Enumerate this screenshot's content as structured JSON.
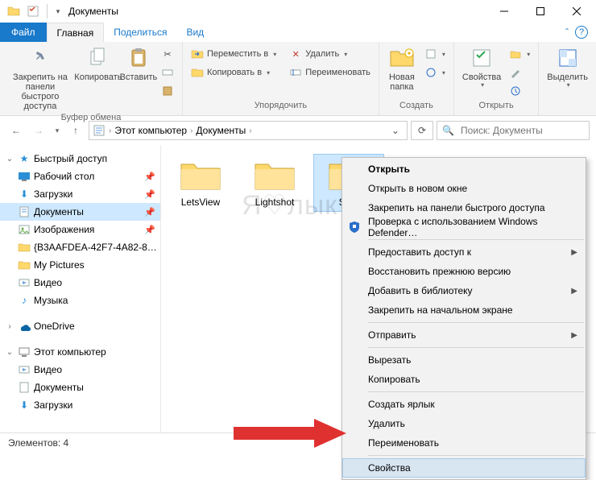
{
  "window": {
    "title": "Документы"
  },
  "tabs": {
    "file": "Файл",
    "home": "Главная",
    "share": "Поделиться",
    "view": "Вид"
  },
  "ribbon": {
    "clipboard": {
      "pin": "Закрепить на панели\nбыстрого доступа",
      "copy": "Копировать",
      "paste": "Вставить",
      "label": "Буфер обмена"
    },
    "organize": {
      "move_to": "Переместить в",
      "copy_to": "Копировать в",
      "delete": "Удалить",
      "rename": "Переименовать",
      "label": "Упорядочить"
    },
    "new": {
      "new_folder": "Новая\nпапка",
      "label": "Создать"
    },
    "open": {
      "properties": "Свойства",
      "label": "Открыть"
    },
    "select": {
      "select": "Выделить",
      "label": ""
    }
  },
  "breadcrumb": {
    "root": "Этот компьютер",
    "current": "Документы"
  },
  "search": {
    "placeholder": "Поиск: Документы"
  },
  "navpane": {
    "quick_access": "Быстрый доступ",
    "desktop": "Рабочий стол",
    "downloads": "Загрузки",
    "documents": "Документы",
    "pictures": "Изображения",
    "guid_folder": "{B3AAFDEA-42F7-4A82-8…",
    "my_pictures": "My Pictures",
    "video": "Видео",
    "music": "Музыка",
    "onedrive": "OneDrive",
    "this_pc": "Этот компьютер",
    "pc_video": "Видео",
    "pc_documents": "Документы",
    "pc_downloads": "Загрузки"
  },
  "items": [
    {
      "name": "LetsView"
    },
    {
      "name": "Lightshot"
    },
    {
      "name": "Secr"
    },
    {
      "name": ""
    }
  ],
  "status": {
    "elements": "Элементов: 4"
  },
  "context_menu": {
    "open": "Открыть",
    "open_new_window": "Открыть в новом окне",
    "pin_quick_access": "Закрепить на панели быстрого доступа",
    "defender": "Проверка с использованием Windows Defender…",
    "give_access": "Предоставить доступ к",
    "restore_previous": "Восстановить прежнюю версию",
    "add_to_library": "Добавить в библиотеку",
    "pin_start": "Закрепить на начальном экране",
    "send_to": "Отправить",
    "cut": "Вырезать",
    "copy": "Копировать",
    "create_shortcut": "Создать ярлык",
    "delete": "Удалить",
    "rename": "Переименовать",
    "properties": "Свойства"
  },
  "watermark": "Я♡лык"
}
